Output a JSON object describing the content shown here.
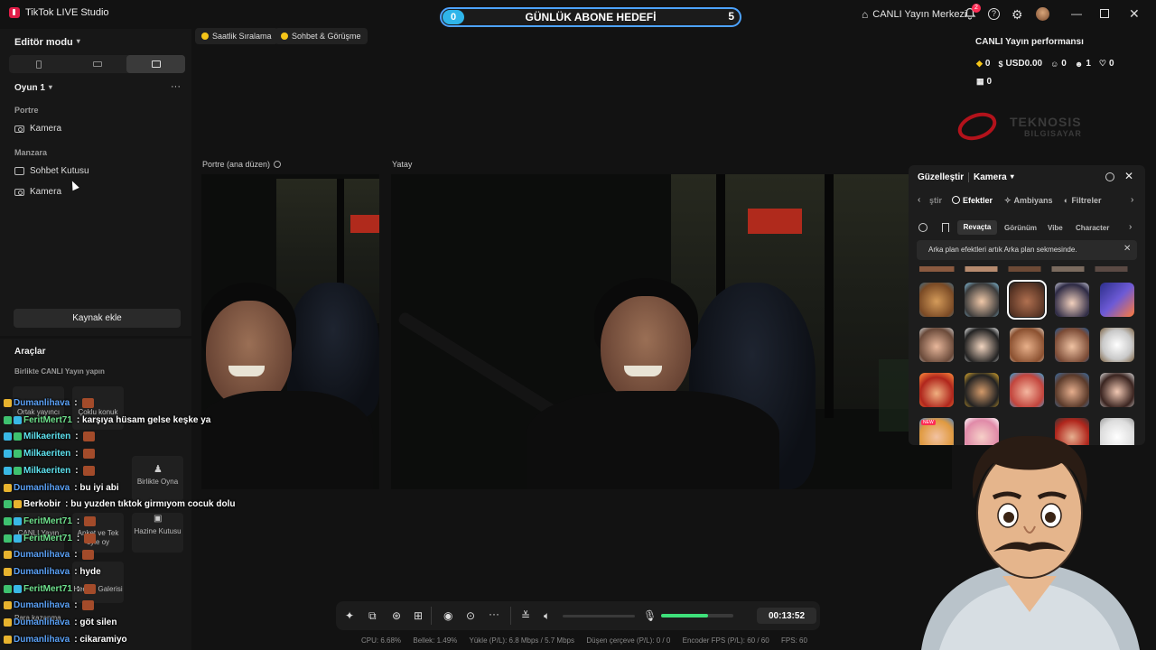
{
  "app": {
    "title": "TikTok LIVE Studio"
  },
  "goal": {
    "title": "GÜNLÜK ABONE HEDEFİ",
    "current": "0",
    "target": "5"
  },
  "titlebar": {
    "live_center": "CANLI Yayın Merkezi",
    "notif_count": "2"
  },
  "left": {
    "editor_mode": "Editör modu",
    "scene": "Oyun 1",
    "portrait_section": "Portre",
    "portrait_items": [
      "Kamera"
    ],
    "landscape_section": "Manzara",
    "landscape_items": [
      "Sohbet Kutusu",
      "Kamera"
    ],
    "add_source": "Kaynak ekle",
    "tools_title": "Araçlar",
    "tools_sub": "Birlikte CANLI Yayın yapın",
    "tools": [
      "Ortak yayıncı",
      "Çoklu konuk",
      "Birlikte Oyna",
      "Anket ve Tek oyle oy",
      "Hazine Kutusu",
      "CANLI Yayın",
      "Hediye Galerisi",
      "Para kazanma"
    ]
  },
  "center": {
    "pills": [
      "Saatlik Sıralama",
      "Sohbet & Görüşme"
    ],
    "portrait_label": "Portre (ana düzen)",
    "landscape_label": "Yatay"
  },
  "perf": {
    "title": "CANLI Yayın performansı",
    "stats": [
      "0",
      "USD0.00",
      "0",
      "1",
      "0"
    ],
    "gifts": "0",
    "watermark_main": "TEKNOSIS",
    "watermark_sub": "BILGISAYAR"
  },
  "beauty": {
    "title": "Güzelleştir",
    "source": "Kamera",
    "tabs": [
      "ştir",
      "Efektler",
      "Ambiyans",
      "Filtreler"
    ],
    "subtabs": [
      "Revaçta",
      "Görünüm",
      "Vibe",
      "Character"
    ],
    "notice": "Arka plan efektleri artık Arka plan sekmesinde.",
    "new_badge": "NEW"
  },
  "chat": [
    {
      "user": "Dumanlihava",
      "msg": ":",
      "color": "blue",
      "emote": true
    },
    {
      "user": "FeritMert71",
      "msg": ": karşıya hüsam gelse keşke ya",
      "color": "green",
      "emote": false
    },
    {
      "user": "Milkaeriten",
      "msg": ":",
      "color": "cyan",
      "emote": true
    },
    {
      "user": "Milkaeriten",
      "msg": ":",
      "color": "cyan",
      "emote": true
    },
    {
      "user": "Milkaeriten",
      "msg": ":",
      "color": "cyan",
      "emote": true
    },
    {
      "user": "Dumanlihava",
      "msg": ": bu iyi abi",
      "color": "blue",
      "emote": false
    },
    {
      "user": "Berkobir",
      "msg": ": bu yuzden tıktok girmıyom cocuk dolu",
      "color": "white",
      "emote": false
    },
    {
      "user": "FeritMert71",
      "msg": ":",
      "color": "green",
      "emote": true
    },
    {
      "user": "FeritMert71",
      "msg": ":",
      "color": "green",
      "emote": true
    },
    {
      "user": "Dumanlihava",
      "msg": ":",
      "color": "blue",
      "emote": true
    },
    {
      "user": "Dumanlihava",
      "msg": ": hyde",
      "color": "blue",
      "emote": false
    },
    {
      "user": "FeritMert71",
      "msg": ":",
      "color": "green",
      "emote": true
    },
    {
      "user": "Dumanlihava",
      "msg": ":",
      "color": "blue",
      "emote": true
    },
    {
      "user": "Dumanlihava",
      "msg": ": göt silen",
      "color": "blue",
      "emote": false
    },
    {
      "user": "Dumanlihava",
      "msg": ": cikaramiyo",
      "color": "blue",
      "emote": false
    }
  ],
  "bottom": {
    "timer": "00:13:52",
    "mic_level": 0.65
  },
  "status": {
    "cpu": "CPU: 6.68%",
    "memory": "Bellek: 1.49%",
    "upload": "Yükle (P/L): 6.8 Mbps / 5.7 Mbps",
    "dropped": "Düşen çerçeve (P/L): 0 / 0",
    "encoder": "Encoder FPS (P/L): 60 / 60",
    "fps": "FPS: 60"
  },
  "colors": {
    "accent": "#4da3ff",
    "goal_fill": "#2fb5ea",
    "mic_green": "#3ee07a",
    "notif": "#ff2d55"
  }
}
